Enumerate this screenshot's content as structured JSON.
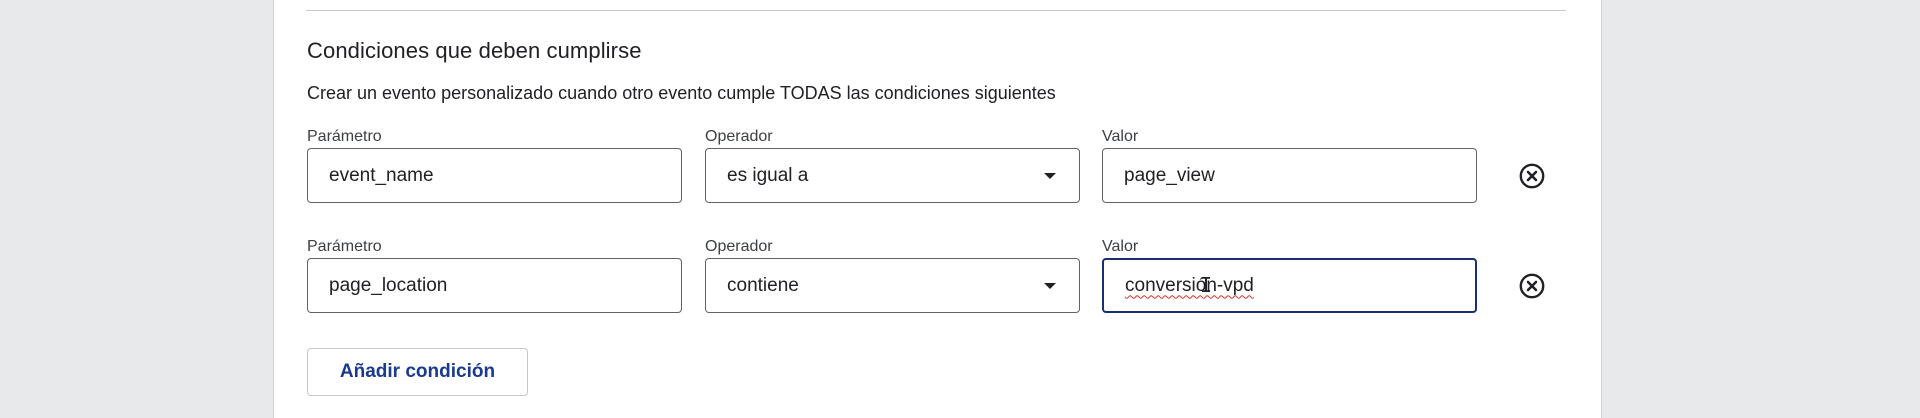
{
  "section": {
    "title": "Condiciones que deben cumplirse",
    "description": "Crear un evento personalizado cuando otro evento cumple TODAS las condiciones siguientes"
  },
  "conditions": [
    {
      "parameter_label": "Parámetro",
      "parameter_value": "event_name",
      "operator_label": "Operador",
      "operator_value": "es igual a",
      "value_label": "Valor",
      "value_value": "page_view"
    },
    {
      "parameter_label": "Parámetro",
      "parameter_value": "page_location",
      "operator_label": "Operador",
      "operator_value": "contiene",
      "value_label": "Valor",
      "value_value": "conversión-vpd"
    }
  ],
  "actions": {
    "add_condition_label": "Añadir condición"
  },
  "icons": {
    "remove": "close-circle-icon",
    "dropdown": "chevron-down-icon",
    "text_cursor": "i-beam-cursor-icon"
  },
  "colors": {
    "accent_text": "#1a3a8f",
    "focus_border": "#1a2f6e",
    "spellcheck": "#d93025"
  }
}
